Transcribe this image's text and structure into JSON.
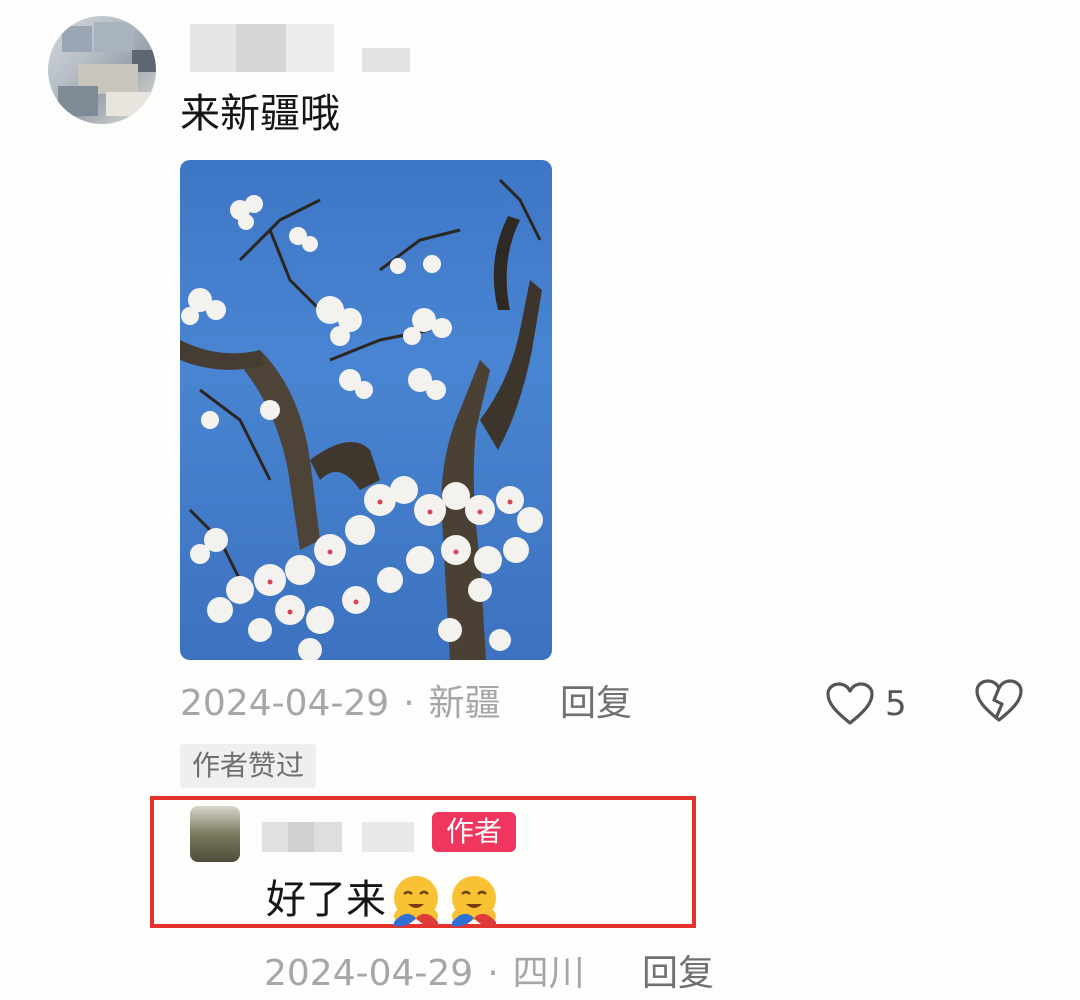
{
  "comment": {
    "text": "来新疆哦",
    "date": "2024-04-29",
    "separator": "·",
    "location": "新疆",
    "reply_label": "回复",
    "like_count": "5",
    "author_liked_badge": "作者赞过"
  },
  "reply": {
    "author_badge": "作者",
    "text": "好了来",
    "emojis": [
      "hugging-face-emoji",
      "hugging-face-emoji"
    ],
    "date": "2024-04-29",
    "separator": "·",
    "location": "四川",
    "reply_label": "回复"
  },
  "colors": {
    "highlight_frame": "#e5322d",
    "author_badge_bg": "#f0355e",
    "meta_text": "#a6a6a6",
    "sky_blue": "#4985d2"
  }
}
